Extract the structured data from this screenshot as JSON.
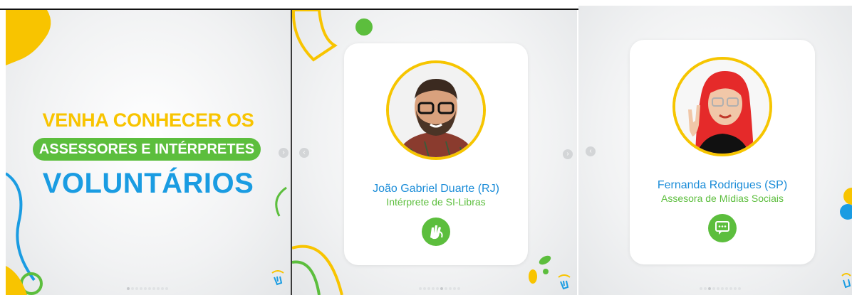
{
  "slide1": {
    "line1": "VENHA CONHECER OS",
    "line2": "ASSESSORES E INTÉRPRETES",
    "line3": "VOLUNTÁRIOS"
  },
  "slide2": {
    "name": "João Gabriel Duarte (RJ)",
    "role": "Intérprete de SI-Libras",
    "badge_icon": "sign-language-icon"
  },
  "slide3": {
    "name": "Fernanda Rodrigues (SP)",
    "role": "Assesora de Mídias Sociais",
    "badge_icon": "chat-bubble-icon"
  },
  "colors": {
    "yellow": "#f8c400",
    "green": "#5cbe3d",
    "blue": "#1a9ce2"
  },
  "pagination": {
    "slide1_active": 1,
    "slide2_active": 6,
    "slide3_active": 3,
    "total": 10
  }
}
